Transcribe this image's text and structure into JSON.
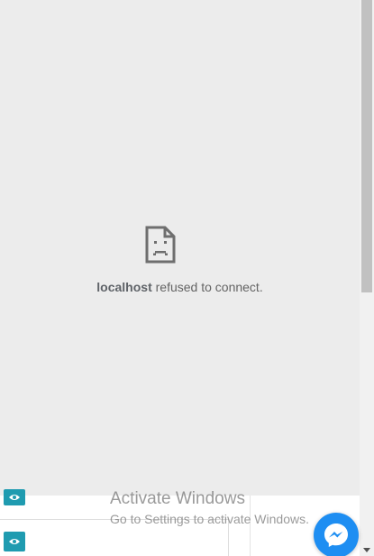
{
  "error": {
    "host": "localhost",
    "message": " refused to connect.",
    "icon": "sad-page-icon"
  },
  "watermark": {
    "title": "Activate Windows",
    "subtitle": "Go to Settings to activate Windows."
  },
  "buttons": {
    "view_icon": "eye-icon",
    "messenger_icon": "messenger-icon"
  },
  "colors": {
    "error_bg": "#ececec",
    "eye_button": "#1f9bb0",
    "messenger": "#1e8ef2"
  }
}
